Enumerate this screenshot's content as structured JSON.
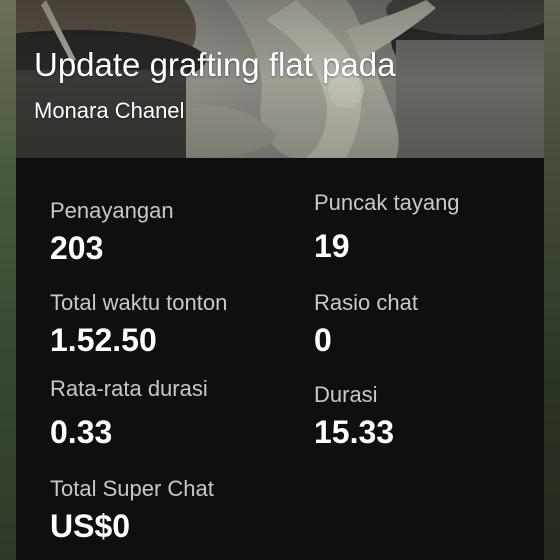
{
  "video": {
    "title": "Update grafting flat pada",
    "channel": "Monara Chanel"
  },
  "stats": {
    "views_label": "Penayangan",
    "views_value": "203",
    "peak_label": "Puncak tayang",
    "peak_value": "19",
    "watch_time_label": "Total waktu tonton",
    "watch_time_value": "1.52.50",
    "chat_rate_label": "Rasio chat",
    "chat_rate_value": "0",
    "avg_duration_label": "Rata-rata durasi",
    "avg_duration_value": "0.33",
    "duration_label": "Durasi",
    "duration_value": "15.33",
    "super_chat_label": "Total Super Chat",
    "super_chat_value": "US$0"
  },
  "colors": {
    "panel_bg": "#0f0f0f",
    "label_text": "#c8c8c8",
    "value_text": "#ffffff"
  }
}
